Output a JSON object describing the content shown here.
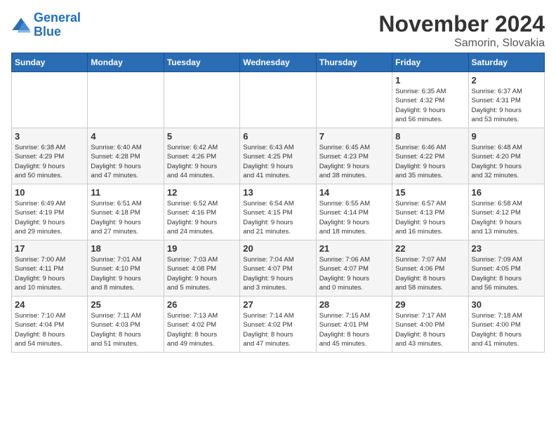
{
  "logo": {
    "line1": "General",
    "line2": "Blue"
  },
  "title": "November 2024",
  "subtitle": "Samorin, Slovakia",
  "days_of_week": [
    "Sunday",
    "Monday",
    "Tuesday",
    "Wednesday",
    "Thursday",
    "Friday",
    "Saturday"
  ],
  "weeks": [
    [
      {
        "day": "",
        "info": ""
      },
      {
        "day": "",
        "info": ""
      },
      {
        "day": "",
        "info": ""
      },
      {
        "day": "",
        "info": ""
      },
      {
        "day": "",
        "info": ""
      },
      {
        "day": "1",
        "info": "Sunrise: 6:35 AM\nSunset: 4:32 PM\nDaylight: 9 hours\nand 56 minutes."
      },
      {
        "day": "2",
        "info": "Sunrise: 6:37 AM\nSunset: 4:31 PM\nDaylight: 9 hours\nand 53 minutes."
      }
    ],
    [
      {
        "day": "3",
        "info": "Sunrise: 6:38 AM\nSunset: 4:29 PM\nDaylight: 9 hours\nand 50 minutes."
      },
      {
        "day": "4",
        "info": "Sunrise: 6:40 AM\nSunset: 4:28 PM\nDaylight: 9 hours\nand 47 minutes."
      },
      {
        "day": "5",
        "info": "Sunrise: 6:42 AM\nSunset: 4:26 PM\nDaylight: 9 hours\nand 44 minutes."
      },
      {
        "day": "6",
        "info": "Sunrise: 6:43 AM\nSunset: 4:25 PM\nDaylight: 9 hours\nand 41 minutes."
      },
      {
        "day": "7",
        "info": "Sunrise: 6:45 AM\nSunset: 4:23 PM\nDaylight: 9 hours\nand 38 minutes."
      },
      {
        "day": "8",
        "info": "Sunrise: 6:46 AM\nSunset: 4:22 PM\nDaylight: 9 hours\nand 35 minutes."
      },
      {
        "day": "9",
        "info": "Sunrise: 6:48 AM\nSunset: 4:20 PM\nDaylight: 9 hours\nand 32 minutes."
      }
    ],
    [
      {
        "day": "10",
        "info": "Sunrise: 6:49 AM\nSunset: 4:19 PM\nDaylight: 9 hours\nand 29 minutes."
      },
      {
        "day": "11",
        "info": "Sunrise: 6:51 AM\nSunset: 4:18 PM\nDaylight: 9 hours\nand 27 minutes."
      },
      {
        "day": "12",
        "info": "Sunrise: 6:52 AM\nSunset: 4:16 PM\nDaylight: 9 hours\nand 24 minutes."
      },
      {
        "day": "13",
        "info": "Sunrise: 6:54 AM\nSunset: 4:15 PM\nDaylight: 9 hours\nand 21 minutes."
      },
      {
        "day": "14",
        "info": "Sunrise: 6:55 AM\nSunset: 4:14 PM\nDaylight: 9 hours\nand 18 minutes."
      },
      {
        "day": "15",
        "info": "Sunrise: 6:57 AM\nSunset: 4:13 PM\nDaylight: 9 hours\nand 16 minutes."
      },
      {
        "day": "16",
        "info": "Sunrise: 6:58 AM\nSunset: 4:12 PM\nDaylight: 9 hours\nand 13 minutes."
      }
    ],
    [
      {
        "day": "17",
        "info": "Sunrise: 7:00 AM\nSunset: 4:11 PM\nDaylight: 9 hours\nand 10 minutes."
      },
      {
        "day": "18",
        "info": "Sunrise: 7:01 AM\nSunset: 4:10 PM\nDaylight: 9 hours\nand 8 minutes."
      },
      {
        "day": "19",
        "info": "Sunrise: 7:03 AM\nSunset: 4:08 PM\nDaylight: 9 hours\nand 5 minutes."
      },
      {
        "day": "20",
        "info": "Sunrise: 7:04 AM\nSunset: 4:07 PM\nDaylight: 9 hours\nand 3 minutes."
      },
      {
        "day": "21",
        "info": "Sunrise: 7:06 AM\nSunset: 4:07 PM\nDaylight: 9 hours\nand 0 minutes."
      },
      {
        "day": "22",
        "info": "Sunrise: 7:07 AM\nSunset: 4:06 PM\nDaylight: 8 hours\nand 58 minutes."
      },
      {
        "day": "23",
        "info": "Sunrise: 7:09 AM\nSunset: 4:05 PM\nDaylight: 8 hours\nand 56 minutes."
      }
    ],
    [
      {
        "day": "24",
        "info": "Sunrise: 7:10 AM\nSunset: 4:04 PM\nDaylight: 8 hours\nand 54 minutes."
      },
      {
        "day": "25",
        "info": "Sunrise: 7:11 AM\nSunset: 4:03 PM\nDaylight: 8 hours\nand 51 minutes."
      },
      {
        "day": "26",
        "info": "Sunrise: 7:13 AM\nSunset: 4:02 PM\nDaylight: 8 hours\nand 49 minutes."
      },
      {
        "day": "27",
        "info": "Sunrise: 7:14 AM\nSunset: 4:02 PM\nDaylight: 8 hours\nand 47 minutes."
      },
      {
        "day": "28",
        "info": "Sunrise: 7:15 AM\nSunset: 4:01 PM\nDaylight: 8 hours\nand 45 minutes."
      },
      {
        "day": "29",
        "info": "Sunrise: 7:17 AM\nSunset: 4:00 PM\nDaylight: 8 hours\nand 43 minutes."
      },
      {
        "day": "30",
        "info": "Sunrise: 7:18 AM\nSunset: 4:00 PM\nDaylight: 8 hours\nand 41 minutes."
      }
    ]
  ]
}
